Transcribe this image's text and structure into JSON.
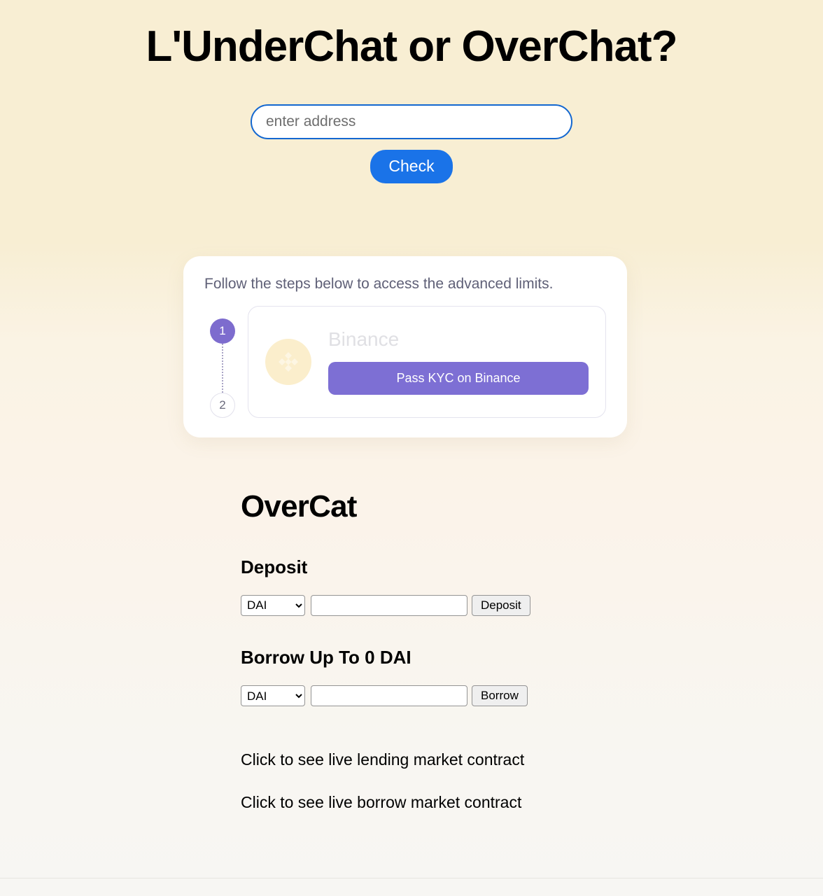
{
  "page": {
    "title": "L'UnderChat or OverChat?"
  },
  "lookup": {
    "input_value": "",
    "input_placeholder": "enter address",
    "check_label": "Check"
  },
  "steps_card": {
    "heading": "Follow the steps below to access the advanced limits.",
    "steps": [
      {
        "number": "1",
        "state": "active"
      },
      {
        "number": "2",
        "state": "inactive"
      }
    ],
    "exchange": {
      "name": "Binance",
      "logo_icon": "binance-logo-icon",
      "action_label": "Pass KYC on Binance"
    },
    "colors": {
      "active_step": "#7d6cce",
      "action_button": "#7d6fd4",
      "logo_background": "#fbeecc"
    }
  },
  "market": {
    "title": "OverCat",
    "deposit": {
      "heading": "Deposit",
      "token_selected": "DAI",
      "token_options": [
        "DAI"
      ],
      "amount_value": "",
      "amount_placeholder": "",
      "button_label": "Deposit"
    },
    "borrow": {
      "heading": "Borrow Up To 0 DAI",
      "token_selected": "DAI",
      "token_options": [
        "DAI"
      ],
      "amount_value": "",
      "amount_placeholder": "",
      "button_label": "Borrow"
    },
    "links": [
      "Click to see live lending market contract",
      "Click to see live borrow market contract"
    ]
  },
  "theme": {
    "background_top": "#f8eed3",
    "background_bottom": "#f7f6f3",
    "primary_blue": "#1a73e8",
    "input_border_blue": "#1367d0",
    "muted_text": "#5f6077"
  }
}
